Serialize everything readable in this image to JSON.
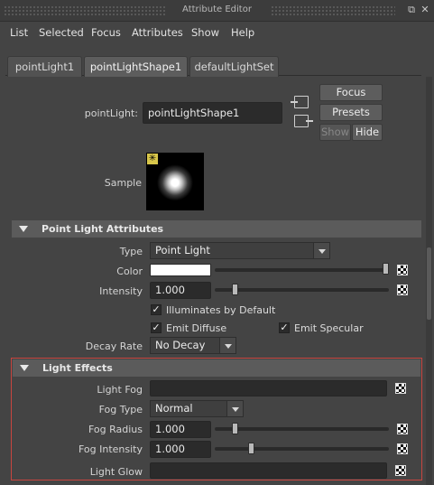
{
  "window": {
    "title": "Attribute Editor"
  },
  "menubar": [
    "List",
    "Selected",
    "Focus",
    "Attributes",
    "Show",
    "Help"
  ],
  "tabs": [
    {
      "label": "pointLight1",
      "active": false
    },
    {
      "label": "pointLightShape1",
      "active": true
    },
    {
      "label": "defaultLightSet",
      "active": false
    }
  ],
  "node": {
    "label": "pointLight:",
    "value": "pointLightShape1"
  },
  "buttons": {
    "focus": "Focus",
    "presets": "Presets",
    "show": "Show",
    "hide": "Hide"
  },
  "sample": {
    "label": "Sample"
  },
  "point_light_section": {
    "title": "Point Light Attributes",
    "type_label": "Type",
    "type_value": "Point Light",
    "color_label": "Color",
    "color_value": "#ffffff",
    "color_slider_fraction": 1.0,
    "intensity_label": "Intensity",
    "intensity_value": "1.000",
    "intensity_slider_fraction": 0.1,
    "illuminates_label": "Illuminates by Default",
    "illuminates_checked": true,
    "emit_diffuse_label": "Emit Diffuse",
    "emit_diffuse_checked": true,
    "emit_specular_label": "Emit Specular",
    "emit_specular_checked": true,
    "decay_label": "Decay Rate",
    "decay_value": "No Decay"
  },
  "light_effects_section": {
    "title": "Light Effects",
    "fog_label": "Light Fog",
    "fog_type_label": "Fog Type",
    "fog_type_value": "Normal",
    "fog_radius_label": "Fog Radius",
    "fog_radius_value": "1.000",
    "fog_radius_slider_fraction": 0.1,
    "fog_intensity_label": "Fog Intensity",
    "fog_intensity_value": "1.000",
    "fog_intensity_slider_fraction": 0.2,
    "glow_label": "Light Glow"
  },
  "colors": {
    "highlight": "#c8453f",
    "background": "#444444"
  }
}
